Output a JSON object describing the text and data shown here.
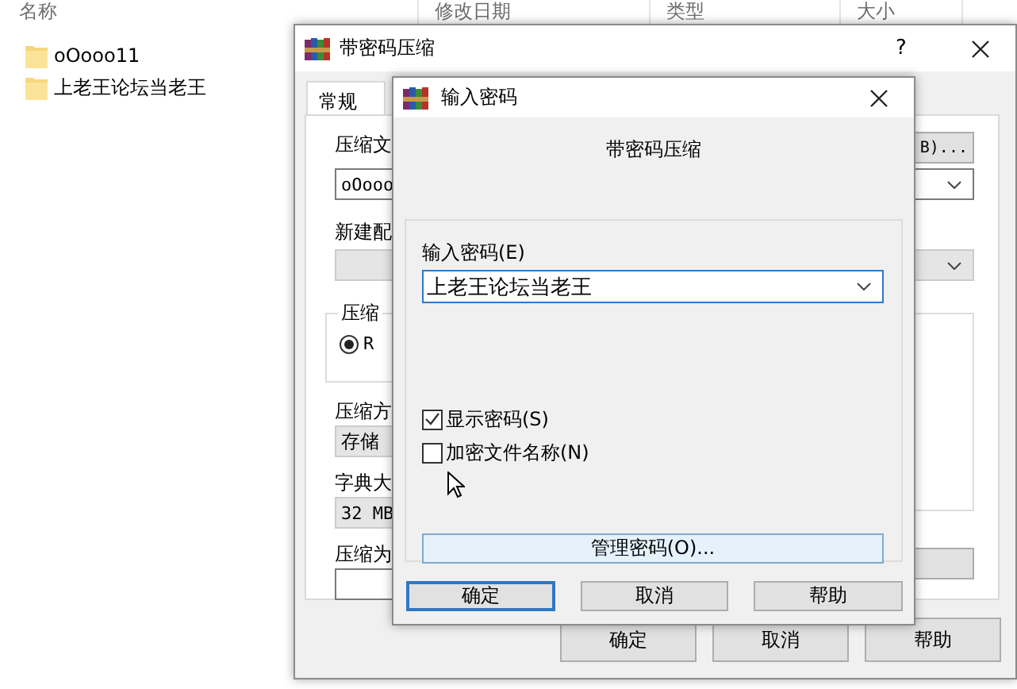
{
  "explorer": {
    "columns": [
      "名称",
      "修改日期",
      "类型",
      "大小"
    ],
    "items": [
      {
        "name": "oOooo11"
      },
      {
        "name": "上老王论坛当老王"
      }
    ]
  },
  "archive_dialog": {
    "title": "带密码压缩",
    "help": "?",
    "tabs": [
      {
        "label": "常规",
        "selected": true
      }
    ],
    "archive_label": "压缩文",
    "browse_button": "B)...",
    "archive_name": "oOooo",
    "profile_label": "新建配",
    "format_group": "压缩",
    "format_option": {
      "label": "R",
      "selected": true
    },
    "method_label": "压缩方",
    "method_value": "存储",
    "dictionary_label": "字典大",
    "dictionary_value": "32 MB",
    "split_label": "压缩为",
    "buttons": [
      "确定",
      "取消",
      "帮助"
    ]
  },
  "password_dialog": {
    "title": "输入密码",
    "heading": "带密码压缩",
    "password_label": "输入密码(E)",
    "password_value": "上老王论坛当老王",
    "options": [
      {
        "label": "显示密码(S)",
        "checked": true
      },
      {
        "label": "加密文件名称(N)",
        "checked": false
      }
    ],
    "manage_button": "管理密码(O)...",
    "buttons": [
      {
        "label": "确定",
        "default": true
      },
      {
        "label": "取消",
        "default": false
      },
      {
        "label": "帮助",
        "default": false
      }
    ]
  }
}
